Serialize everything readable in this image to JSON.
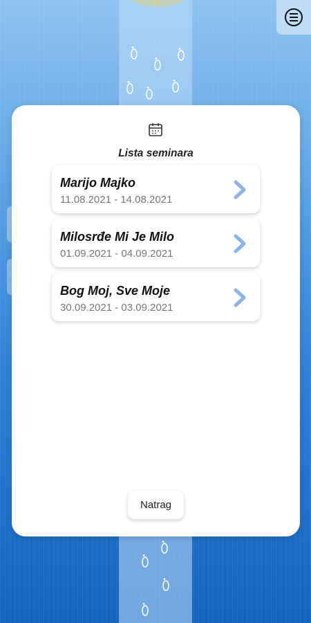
{
  "header": {
    "menu_icon": "hamburger-circle-icon"
  },
  "dialog": {
    "icon": "calendar-icon",
    "title": "Lista seminara",
    "items": [
      {
        "name": "Marijo Majko",
        "dates": "11.08.2021 - 14.08.2021"
      },
      {
        "name": "Milosrđe Mi Je Milo",
        "dates": "01.09.2021 - 04.09.2021"
      },
      {
        "name": "Bog Moj, Sve Moje",
        "dates": "30.09.2021 - 03.09.2021"
      }
    ],
    "back_label": "Natrag"
  },
  "colors": {
    "accent": "#8ab4e6",
    "sun": "#f5c431"
  }
}
